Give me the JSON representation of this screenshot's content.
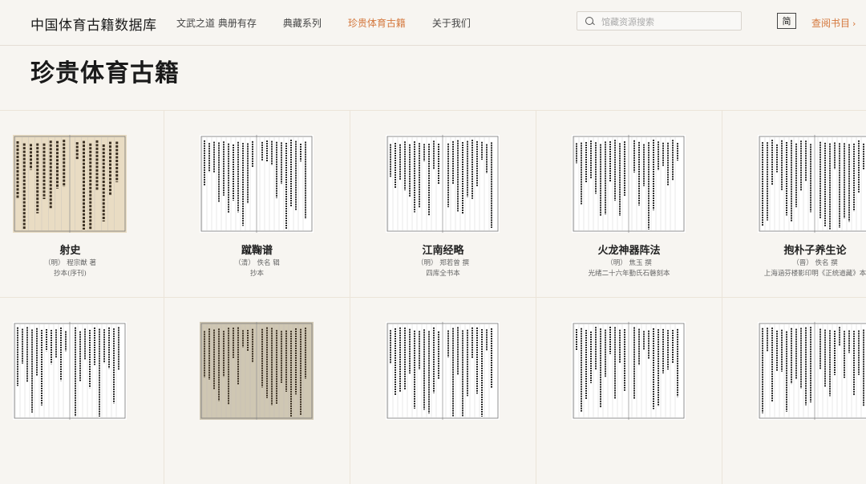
{
  "header": {
    "logo": "中国体育古籍数据库",
    "nav": [
      {
        "label": "文武之道 典册有存",
        "active": false
      },
      {
        "label": "典藏系列",
        "active": false
      },
      {
        "label": "珍贵体育古籍",
        "active": true
      },
      {
        "label": "关于我们",
        "active": false
      }
    ],
    "search_placeholder": "馆藏资源搜索",
    "lang_label": "简",
    "guide_label": "查阅书目",
    "guide_icon": "chevron-right-icon",
    "accent_color": "#d4773c"
  },
  "page_title": "珍贵体育古籍",
  "books_row1": [
    {
      "title": "射史",
      "author": "（明） 程宗猷 著",
      "edition": "抄本(序刊)",
      "tone": "#e9dcc3"
    },
    {
      "title": "蹴鞠谱",
      "author": "（清） 佚名 辑",
      "edition": "抄本",
      "tone": "#ffffff"
    },
    {
      "title": "江南经略",
      "author": "（明） 郑若曾 撰",
      "edition": "四库全书本",
      "tone": "#ffffff"
    },
    {
      "title": "火龙神器阵法",
      "author": "（明） 焦玉 撰",
      "edition": "光绪二十六年勤氏石磬刻本",
      "tone": "#ffffff"
    },
    {
      "title": "抱朴子养生论",
      "author": "（晋） 佚名 撰",
      "edition": "上海涵芬楼影印明《正统道藏》本",
      "tone": "#ffffff"
    }
  ],
  "books_row2": [
    {
      "tone": "#ffffff"
    },
    {
      "tone": "#cfc7b3"
    },
    {
      "tone": "#ffffff"
    },
    {
      "tone": "#ffffff"
    },
    {
      "tone": "#ffffff"
    }
  ]
}
